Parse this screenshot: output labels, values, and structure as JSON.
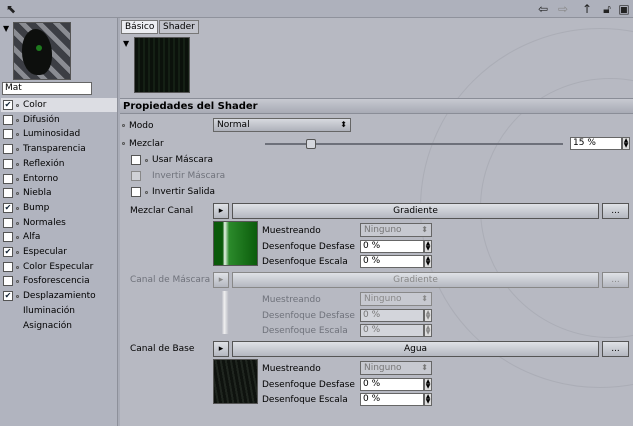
{
  "window": {
    "icons": [
      "pin-icon",
      "arrow-left-icon",
      "arrow-right-icon",
      "lock-icon",
      "window-icon"
    ]
  },
  "left": {
    "material_name": "Mat",
    "channels": [
      {
        "label": "Color",
        "checked": true,
        "selected": true
      },
      {
        "label": "Difusión",
        "checked": false
      },
      {
        "label": "Luminosidad",
        "checked": false
      },
      {
        "label": "Transparencia",
        "checked": false
      },
      {
        "label": "Reflexión",
        "checked": false
      },
      {
        "label": "Entorno",
        "checked": false
      },
      {
        "label": "Niebla",
        "checked": false
      },
      {
        "label": "Bump",
        "checked": true
      },
      {
        "label": "Normales",
        "checked": false
      },
      {
        "label": "Alfa",
        "checked": false
      },
      {
        "label": "Especular",
        "checked": true
      },
      {
        "label": "Color Especular",
        "checked": false
      },
      {
        "label": "Fosforescencia",
        "checked": false
      },
      {
        "label": "Desplazamiento",
        "checked": true
      },
      {
        "label": "Iluminación",
        "checkbox": false
      },
      {
        "label": "Asignación",
        "checkbox": false
      }
    ]
  },
  "tabs": [
    "Básico",
    "Shader"
  ],
  "section_title": "Propiedades del Shader",
  "modo": {
    "label": "Modo",
    "value": "Normal"
  },
  "mezclar": {
    "label": "Mezclar",
    "value": "15 %",
    "fraction": 0.15
  },
  "options": [
    {
      "label": "Usar Máscara",
      "dim": false
    },
    {
      "label": "Invertir Máscara",
      "dim": true
    },
    {
      "label": "Invertir Salida",
      "dim": false
    }
  ],
  "channels": [
    {
      "label": "Mezclar Canal",
      "shader": "Gradiente",
      "dim": false,
      "muestreando": "Muestreando",
      "muestreo_val": "Ninguno",
      "desf_label": "Desenfoque Desfase",
      "desf_val": "0 %",
      "esc_label": "Desenfoque Escala",
      "esc_val": "0 %",
      "more": "..."
    },
    {
      "label": "Canal de Máscara",
      "shader": "Gradiente",
      "dim": true,
      "muestreando": "Muestreando",
      "muestreo_val": "Ninguno",
      "desf_label": "Desenfoque Desfase",
      "desf_val": "0 %",
      "esc_label": "Desenfoque Escala",
      "esc_val": "0 %",
      "more": "..."
    },
    {
      "label": "Canal de Base",
      "shader": "Agua",
      "dim": false,
      "muestreando": "Muestreando",
      "muestreo_val": "Ninguno",
      "desf_label": "Desenfoque Desfase",
      "desf_val": "0 %",
      "esc_label": "Desenfoque Escala",
      "esc_val": "0 %",
      "more": "..."
    }
  ]
}
